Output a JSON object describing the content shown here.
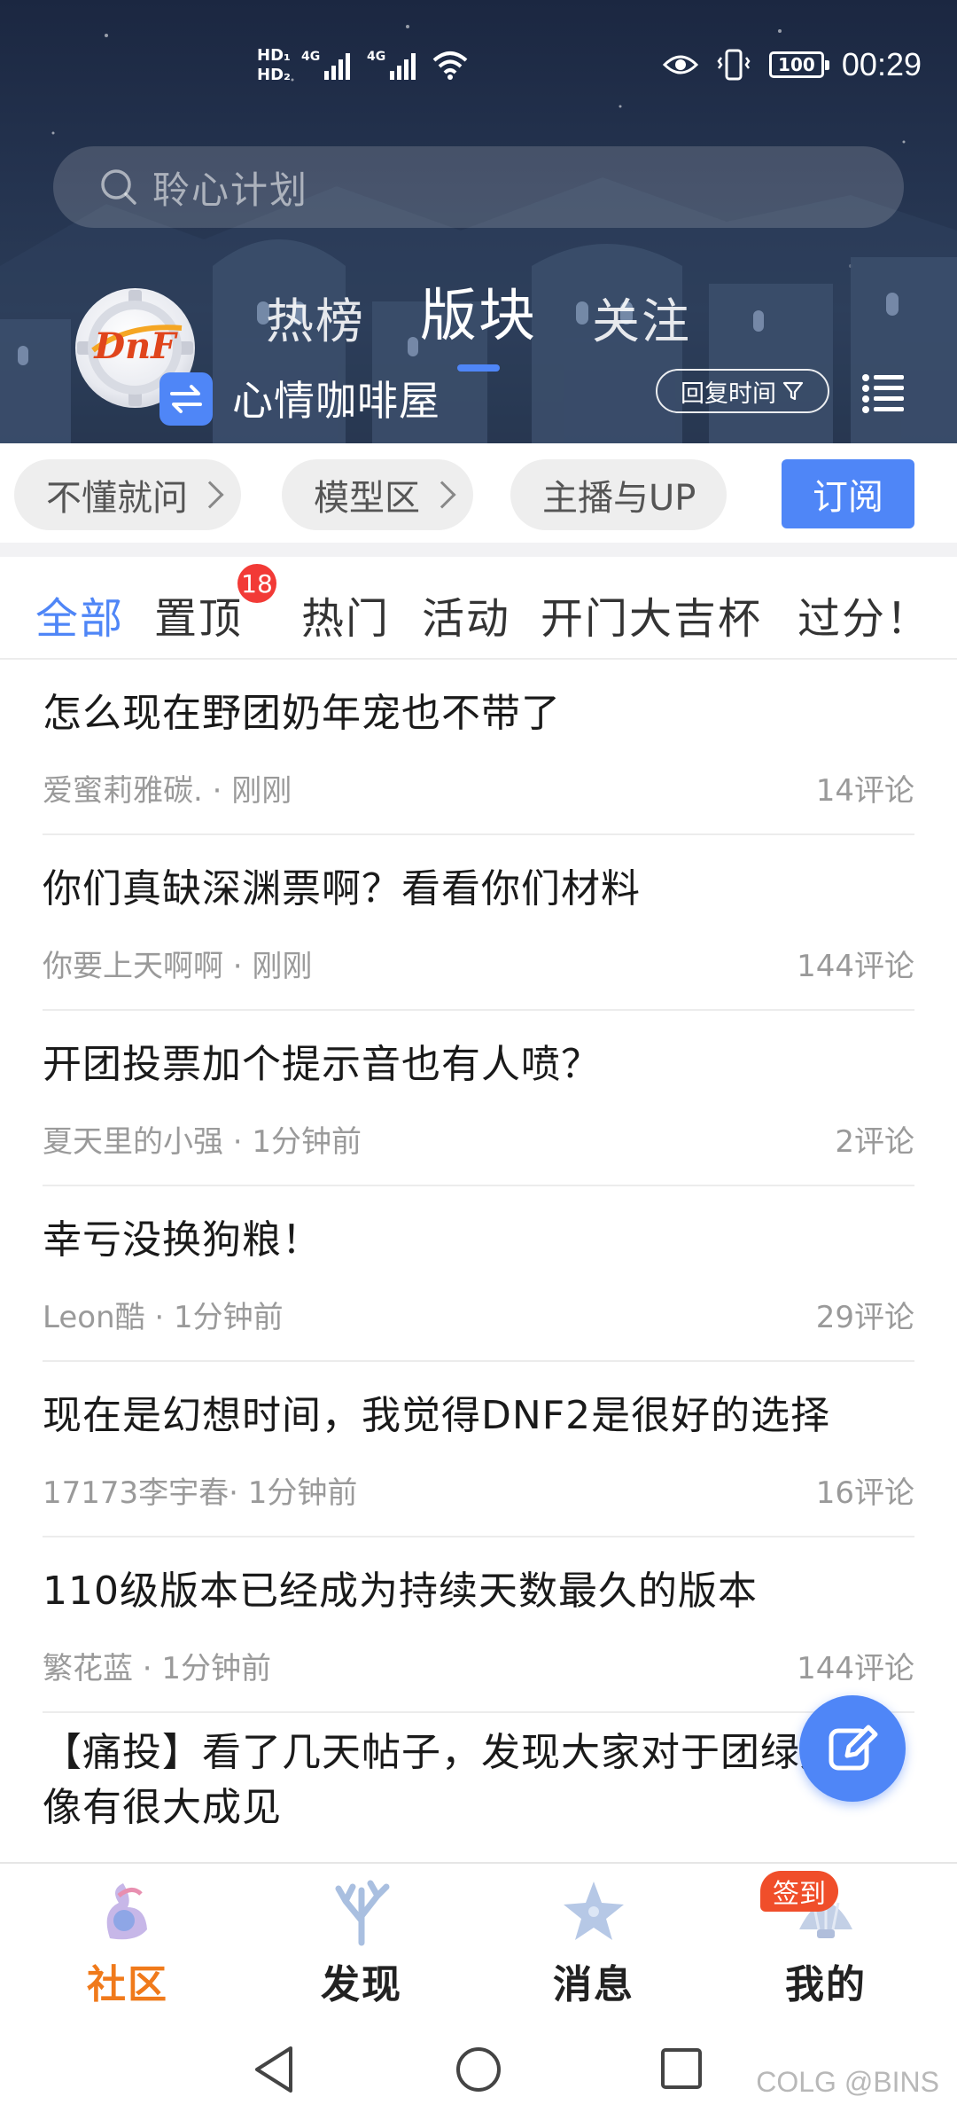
{
  "status_bar": {
    "hd1": "HD₁",
    "hd2": "HD₂",
    "sig1": "4G",
    "sig2": "4G",
    "battery": "100",
    "time": "00:29"
  },
  "search": {
    "placeholder": "聆心计划"
  },
  "top_tabs": [
    {
      "label": "热榜",
      "active": false
    },
    {
      "label": "版块",
      "active": true
    },
    {
      "label": "关注",
      "active": false
    }
  ],
  "forum": {
    "logo_text": "DnF",
    "name": "心情咖啡屋",
    "sort_label": "回复时间"
  },
  "chips": [
    {
      "label": "不懂就问"
    },
    {
      "label": "模型区"
    },
    {
      "label": "主播与UP"
    }
  ],
  "subscribe_label": "订阅",
  "filters": [
    {
      "label": "全部",
      "active": true
    },
    {
      "label": "置顶",
      "active": false
    },
    {
      "label": "热门",
      "active": false
    },
    {
      "label": "活动",
      "active": false
    },
    {
      "label": "开门大吉杯",
      "active": false
    },
    {
      "label": "过分！",
      "active": false
    }
  ],
  "pinned_badge": "18",
  "posts": [
    {
      "title": "怎么现在野团奶年宠也不带了",
      "meta": "爱蜜莉雅碳. · 刚刚",
      "comments": "14评论"
    },
    {
      "title": "你们真缺深渊票啊？看看你们材料",
      "meta": "你要上天啊啊 · 刚刚",
      "comments": "144评论"
    },
    {
      "title": "开团投票加个提示音也有人喷？",
      "meta": "夏天里的小强 · 1分钟前",
      "comments": "2评论"
    },
    {
      "title": "幸亏没换狗粮！",
      "meta": "Leon酷 · 1分钟前",
      "comments": "29评论"
    },
    {
      "title": "现在是幻想时间，我觉得DNF2是很好的选择",
      "meta": "17173李宇春· 1分钟前",
      "comments": "16评论"
    },
    {
      "title": "110级版本已经成为持续天数最久的版本",
      "meta": "繁花蓝 · 1分钟前",
      "comments": "144评论"
    },
    {
      "title": "【痛投】看了几天帖子，发现大家对于团绿好像有很大成见",
      "meta": "",
      "comments": ""
    }
  ],
  "bottom_nav": [
    {
      "label": "社区",
      "icon": "community-icon",
      "active": true
    },
    {
      "label": "发现",
      "icon": "discover-icon",
      "active": false
    },
    {
      "label": "消息",
      "icon": "message-icon",
      "active": false
    },
    {
      "label": "我的",
      "icon": "profile-icon",
      "active": false
    }
  ],
  "sign_in_badge": "签到",
  "watermark": "COLG @BINS",
  "colors": {
    "accent": "#4f86f7",
    "nav_active": "#f07a1b",
    "badge": "#f23a36"
  }
}
